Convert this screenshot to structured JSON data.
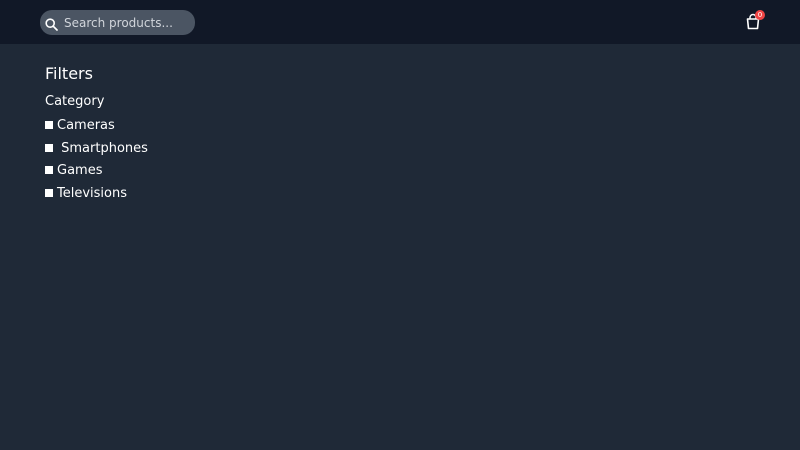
{
  "header": {
    "search": {
      "placeholder": "Search products...",
      "value": ""
    },
    "cart": {
      "count": "0",
      "icon": "shopping-bag-icon",
      "badge_color": "#ef4444"
    }
  },
  "filters": {
    "title": "Filters",
    "category": {
      "title": "Category",
      "items": [
        {
          "label": "Cameras",
          "checked": false
        },
        {
          "label": "Smartphones",
          "checked": false
        },
        {
          "label": "Games",
          "checked": false
        },
        {
          "label": "Televisions",
          "checked": false
        }
      ]
    }
  },
  "colors": {
    "background": "#1f2937",
    "header": "#111827",
    "search_bg": "#4b5563"
  }
}
